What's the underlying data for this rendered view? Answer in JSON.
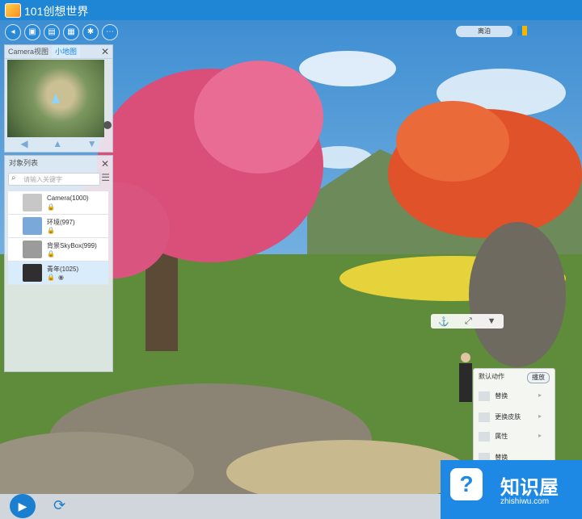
{
  "window": {
    "title": "101创想世界"
  },
  "camera_panel": {
    "tabs": [
      "Camera视图",
      "小地图"
    ],
    "active_tab": 1
  },
  "object_panel": {
    "title": "对象列表",
    "search_placeholder": "请输入关键字",
    "items": [
      {
        "name": "Camera(1000)"
      },
      {
        "name": "环境(997)"
      },
      {
        "name": "背景SkyBox(999)"
      },
      {
        "name": "青年(1025)"
      }
    ]
  },
  "top_right": {
    "label": "离泊"
  },
  "action_panel": {
    "default_action": "默认动作",
    "play_label": "播放",
    "rows": [
      "替换",
      "更换皮肤",
      "属性",
      "替换"
    ]
  },
  "watermark": {
    "title": "知识屋",
    "url": "zhishiwu.com"
  }
}
